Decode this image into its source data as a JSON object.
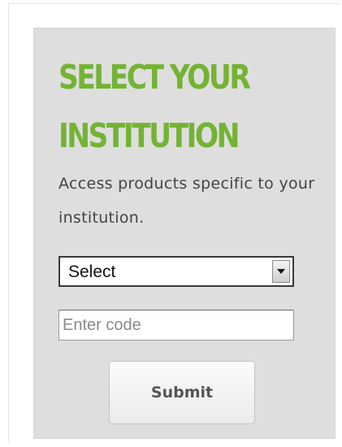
{
  "institution_widget": {
    "title": "SELECT YOUR\nINSTITUTION",
    "description": "Access products specific to your institution.",
    "select": {
      "selected_value": "Select"
    },
    "code_field": {
      "value": "",
      "placeholder": "Enter code"
    },
    "submit_label": "Submit",
    "title_color": "#74b334",
    "panel_color": "#dedede"
  }
}
